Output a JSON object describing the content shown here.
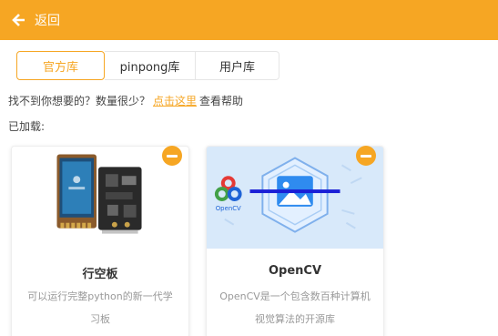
{
  "header": {
    "back_label": "返回",
    "back_icon": "arrow-left-icon",
    "color": "#F6A623"
  },
  "tabs": [
    {
      "label": "官方库",
      "active": true
    },
    {
      "label": "pinpong库",
      "active": false
    },
    {
      "label": "用户库",
      "active": false
    }
  ],
  "help": {
    "prefix": "找不到你想要的？数量很少？",
    "link": "点击这里",
    "suffix": "查看帮助"
  },
  "loaded_label": "已加载:",
  "cards": [
    {
      "title": "行空板",
      "desc": "可以运行完整python的新一代学习板",
      "image": "unihiker-board-photo",
      "remove_icon": "minus-circle-icon"
    },
    {
      "title": "OpenCV",
      "desc": "OpenCV是一个包含数百种计算机视觉算法的开源库",
      "image": "opencv-logo-banner",
      "logo_text": "OpenCV",
      "remove_icon": "minus-circle-icon"
    }
  ]
}
